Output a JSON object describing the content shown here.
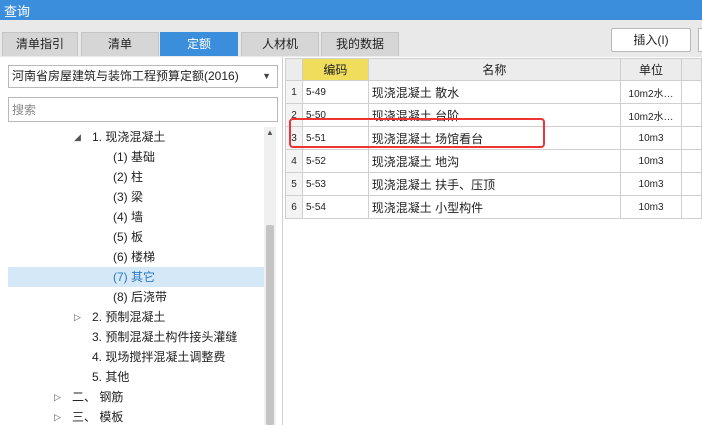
{
  "window": {
    "title": "查询"
  },
  "tabs": [
    {
      "label": "清单指引"
    },
    {
      "label": "清单"
    },
    {
      "label": "定额"
    },
    {
      "label": "人材机"
    },
    {
      "label": "我的数据"
    }
  ],
  "active_tab": "定额",
  "insert_button": {
    "label": "插入(I)"
  },
  "quota_dropdown": {
    "value": "河南省房屋建筑与装饰工程预算定额(2016)"
  },
  "search": {
    "placeholder": "搜索"
  },
  "tree": [
    {
      "label": "1. 现浇混凝土",
      "expanded": true
    },
    {
      "label": "(1) 基础"
    },
    {
      "label": "(2) 柱"
    },
    {
      "label": "(3) 梁"
    },
    {
      "label": "(4) 墙"
    },
    {
      "label": "(5) 板"
    },
    {
      "label": "(6) 楼梯"
    },
    {
      "label": "(7) 其它",
      "selected": true
    },
    {
      "label": "(8) 后浇带"
    },
    {
      "label": "2. 预制混凝土",
      "expanded": false
    },
    {
      "label": "3. 预制混凝土构件接头灌缝"
    },
    {
      "label": "4. 现场搅拌混凝土调整费"
    },
    {
      "label": "5. 其他"
    },
    {
      "label": "二、 钢筋",
      "expanded": false
    },
    {
      "label": "三、 模板",
      "expanded": false
    }
  ],
  "table": {
    "headers": {
      "code": "编码",
      "name": "名称",
      "unit": "单位"
    },
    "rows": [
      {
        "no": "1",
        "code": "5-49",
        "name": "现浇混凝土 散水",
        "unit": "10m2水…"
      },
      {
        "no": "2",
        "code": "5-50",
        "name": "现浇混凝土 台阶",
        "unit": "10m2水…"
      },
      {
        "no": "3",
        "code": "5-51",
        "name": "现浇混凝土 场馆看台",
        "unit": "10m3"
      },
      {
        "no": "4",
        "code": "5-52",
        "name": "现浇混凝土 地沟",
        "unit": "10m3"
      },
      {
        "no": "5",
        "code": "5-53",
        "name": "现浇混凝土 扶手、压顶",
        "unit": "10m3"
      },
      {
        "no": "6",
        "code": "5-54",
        "name": "现浇混凝土 小型构件",
        "unit": "10m3"
      }
    ]
  },
  "colors": {
    "accent": "#3b8edc",
    "code_header": "#f0dd5c",
    "highlight": "#e33333",
    "selected_row": "#d5e8f7"
  }
}
